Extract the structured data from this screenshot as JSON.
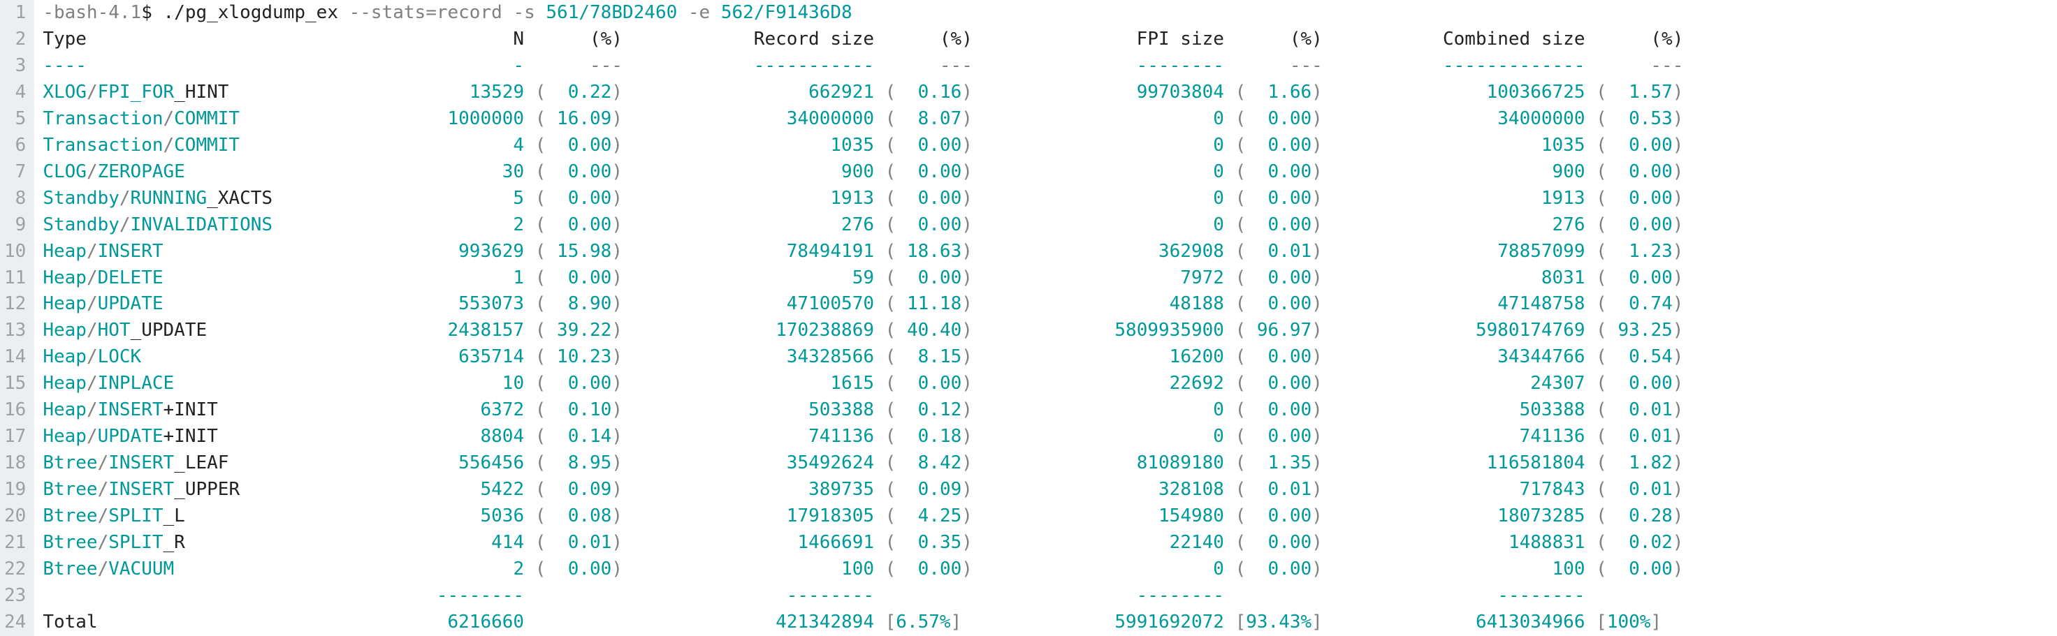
{
  "prompt_prefix": "-bash-4.1",
  "prompt_sigil": "$",
  "cmd": "./pg_xlogdump_ex",
  "flag_stats": "--stats=record",
  "flag_s": "-s",
  "arg_s": "561/78BD2460",
  "flag_e": "-e",
  "arg_e": "562/F91436D8",
  "headers": {
    "type": "Type",
    "n": "N",
    "pct": "(%)",
    "record_size": "Record size",
    "fpi_size": "FPI size",
    "combined_size": "Combined size"
  },
  "dashes": {
    "type": "----",
    "n": "-",
    "pct": "---",
    "record_size": "-----------",
    "fpi_size": "--------",
    "combined_size": "-------------"
  },
  "rows": [
    {
      "name_a": "XLOG",
      "slash": "/",
      "name_b": "FPI_FOR",
      "name_c": "_HINT",
      "n": "13529",
      "npct": "0.22",
      "rs": "662921",
      "rspct": "0.16",
      "fpi": "99703804",
      "fpipct": "1.66",
      "cs": "100366725",
      "cspct": "1.57"
    },
    {
      "name_a": "Transaction",
      "slash": "/",
      "name_b": "COMMIT",
      "name_c": "",
      "n": "1000000",
      "npct": "16.09",
      "rs": "34000000",
      "rspct": "8.07",
      "fpi": "0",
      "fpipct": "0.00",
      "cs": "34000000",
      "cspct": "0.53"
    },
    {
      "name_a": "Transaction",
      "slash": "/",
      "name_b": "COMMIT",
      "name_c": "",
      "n": "4",
      "npct": "0.00",
      "rs": "1035",
      "rspct": "0.00",
      "fpi": "0",
      "fpipct": "0.00",
      "cs": "1035",
      "cspct": "0.00"
    },
    {
      "name_a": "CLOG",
      "slash": "/",
      "name_b": "ZEROPAGE",
      "name_c": "",
      "n": "30",
      "npct": "0.00",
      "rs": "900",
      "rspct": "0.00",
      "fpi": "0",
      "fpipct": "0.00",
      "cs": "900",
      "cspct": "0.00"
    },
    {
      "name_a": "Standby",
      "slash": "/",
      "name_b": "RUNNING",
      "name_c": "_XACTS",
      "n": "5",
      "npct": "0.00",
      "rs": "1913",
      "rspct": "0.00",
      "fpi": "0",
      "fpipct": "0.00",
      "cs": "1913",
      "cspct": "0.00"
    },
    {
      "name_a": "Standby",
      "slash": "/",
      "name_b": "INVALIDATIONS",
      "name_c": "",
      "n": "2",
      "npct": "0.00",
      "rs": "276",
      "rspct": "0.00",
      "fpi": "0",
      "fpipct": "0.00",
      "cs": "276",
      "cspct": "0.00"
    },
    {
      "name_a": "Heap",
      "slash": "/",
      "name_b": "INSERT",
      "name_c": "",
      "n": "993629",
      "npct": "15.98",
      "rs": "78494191",
      "rspct": "18.63",
      "fpi": "362908",
      "fpipct": "0.01",
      "cs": "78857099",
      "cspct": "1.23"
    },
    {
      "name_a": "Heap",
      "slash": "/",
      "name_b": "DELETE",
      "name_c": "",
      "n": "1",
      "npct": "0.00",
      "rs": "59",
      "rspct": "0.00",
      "fpi": "7972",
      "fpipct": "0.00",
      "cs": "8031",
      "cspct": "0.00"
    },
    {
      "name_a": "Heap",
      "slash": "/",
      "name_b": "UPDATE",
      "name_c": "",
      "n": "553073",
      "npct": "8.90",
      "rs": "47100570",
      "rspct": "11.18",
      "fpi": "48188",
      "fpipct": "0.00",
      "cs": "47148758",
      "cspct": "0.74"
    },
    {
      "name_a": "Heap",
      "slash": "/",
      "name_b": "HOT",
      "name_c": "_UPDATE",
      "n": "2438157",
      "npct": "39.22",
      "rs": "170238869",
      "rspct": "40.40",
      "fpi": "5809935900",
      "fpipct": "96.97",
      "cs": "5980174769",
      "cspct": "93.25"
    },
    {
      "name_a": "Heap",
      "slash": "/",
      "name_b": "LOCK",
      "name_c": "",
      "n": "635714",
      "npct": "10.23",
      "rs": "34328566",
      "rspct": "8.15",
      "fpi": "16200",
      "fpipct": "0.00",
      "cs": "34344766",
      "cspct": "0.54"
    },
    {
      "name_a": "Heap",
      "slash": "/",
      "name_b": "INPLACE",
      "name_c": "",
      "n": "10",
      "npct": "0.00",
      "rs": "1615",
      "rspct": "0.00",
      "fpi": "22692",
      "fpipct": "0.00",
      "cs": "24307",
      "cspct": "0.00"
    },
    {
      "name_a": "Heap",
      "slash": "/",
      "name_b": "INSERT",
      "name_c": "+INIT",
      "n": "6372",
      "npct": "0.10",
      "rs": "503388",
      "rspct": "0.12",
      "fpi": "0",
      "fpipct": "0.00",
      "cs": "503388",
      "cspct": "0.01"
    },
    {
      "name_a": "Heap",
      "slash": "/",
      "name_b": "UPDATE",
      "name_c": "+INIT",
      "n": "8804",
      "npct": "0.14",
      "rs": "741136",
      "rspct": "0.18",
      "fpi": "0",
      "fpipct": "0.00",
      "cs": "741136",
      "cspct": "0.01"
    },
    {
      "name_a": "Btree",
      "slash": "/",
      "name_b": "INSERT",
      "name_c": "_LEAF",
      "n": "556456",
      "npct": "8.95",
      "rs": "35492624",
      "rspct": "8.42",
      "fpi": "81089180",
      "fpipct": "1.35",
      "cs": "116581804",
      "cspct": "1.82"
    },
    {
      "name_a": "Btree",
      "slash": "/",
      "name_b": "INSERT",
      "name_c": "_UPPER",
      "n": "5422",
      "npct": "0.09",
      "rs": "389735",
      "rspct": "0.09",
      "fpi": "328108",
      "fpipct": "0.01",
      "cs": "717843",
      "cspct": "0.01"
    },
    {
      "name_a": "Btree",
      "slash": "/",
      "name_b": "SPLIT",
      "name_c": "_L",
      "n": "5036",
      "npct": "0.08",
      "rs": "17918305",
      "rspct": "4.25",
      "fpi": "154980",
      "fpipct": "0.00",
      "cs": "18073285",
      "cspct": "0.28"
    },
    {
      "name_a": "Btree",
      "slash": "/",
      "name_b": "SPLIT",
      "name_c": "_R",
      "n": "414",
      "npct": "0.01",
      "rs": "1466691",
      "rspct": "0.35",
      "fpi": "22140",
      "fpipct": "0.00",
      "cs": "1488831",
      "cspct": "0.02"
    },
    {
      "name_a": "Btree",
      "slash": "/",
      "name_b": "VACUUM",
      "name_c": "",
      "n": "2",
      "npct": "0.00",
      "rs": "100",
      "rspct": "0.00",
      "fpi": "0",
      "fpipct": "0.00",
      "cs": "100",
      "cspct": "0.00"
    }
  ],
  "dashes2": {
    "n": "--------",
    "rs": "--------",
    "fpi": "--------",
    "cs": "--------"
  },
  "total": {
    "label": "Total",
    "n": "6216660",
    "rs": "421342894",
    "rspct": "6.57%",
    "fpi": "5991692072",
    "fpipct": "93.43%",
    "cs": "6413034966",
    "cspct": "100%"
  },
  "chart_data": {
    "type": "table",
    "title": "pg_xlogdump_ex --stats=record",
    "columns": [
      "Type",
      "N",
      "N %",
      "Record size",
      "Record size %",
      "FPI size",
      "FPI size %",
      "Combined size",
      "Combined size %"
    ],
    "rows": [
      [
        "XLOG/FPI_FOR_HINT",
        13529,
        0.22,
        662921,
        0.16,
        99703804,
        1.66,
        100366725,
        1.57
      ],
      [
        "Transaction/COMMIT",
        1000000,
        16.09,
        34000000,
        8.07,
        0,
        0.0,
        34000000,
        0.53
      ],
      [
        "Transaction/COMMIT",
        4,
        0.0,
        1035,
        0.0,
        0,
        0.0,
        1035,
        0.0
      ],
      [
        "CLOG/ZEROPAGE",
        30,
        0.0,
        900,
        0.0,
        0,
        0.0,
        900,
        0.0
      ],
      [
        "Standby/RUNNING_XACTS",
        5,
        0.0,
        1913,
        0.0,
        0,
        0.0,
        1913,
        0.0
      ],
      [
        "Standby/INVALIDATIONS",
        2,
        0.0,
        276,
        0.0,
        0,
        0.0,
        276,
        0.0
      ],
      [
        "Heap/INSERT",
        993629,
        15.98,
        78494191,
        18.63,
        362908,
        0.01,
        78857099,
        1.23
      ],
      [
        "Heap/DELETE",
        1,
        0.0,
        59,
        0.0,
        7972,
        0.0,
        8031,
        0.0
      ],
      [
        "Heap/UPDATE",
        553073,
        8.9,
        47100570,
        11.18,
        48188,
        0.0,
        47148758,
        0.74
      ],
      [
        "Heap/HOT_UPDATE",
        2438157,
        39.22,
        170238869,
        40.4,
        5809935900,
        96.97,
        5980174769,
        93.25
      ],
      [
        "Heap/LOCK",
        635714,
        10.23,
        34328566,
        8.15,
        16200,
        0.0,
        34344766,
        0.54
      ],
      [
        "Heap/INPLACE",
        10,
        0.0,
        1615,
        0.0,
        22692,
        0.0,
        24307,
        0.0
      ],
      [
        "Heap/INSERT+INIT",
        6372,
        0.1,
        503388,
        0.12,
        0,
        0.0,
        503388,
        0.01
      ],
      [
        "Heap/UPDATE+INIT",
        8804,
        0.14,
        741136,
        0.18,
        0,
        0.0,
        741136,
        0.01
      ],
      [
        "Btree/INSERT_LEAF",
        556456,
        8.95,
        35492624,
        8.42,
        81089180,
        1.35,
        116581804,
        1.82
      ],
      [
        "Btree/INSERT_UPPER",
        5422,
        0.09,
        389735,
        0.09,
        328108,
        0.01,
        717843,
        0.01
      ],
      [
        "Btree/SPLIT_L",
        5036,
        0.08,
        17918305,
        4.25,
        154980,
        0.0,
        18073285,
        0.28
      ],
      [
        "Btree/SPLIT_R",
        414,
        0.01,
        1466691,
        0.35,
        22140,
        0.0,
        1488831,
        0.02
      ],
      [
        "Btree/VACUUM",
        2,
        0.0,
        100,
        0.0,
        0,
        0.0,
        100,
        0.0
      ]
    ],
    "total": [
      "Total",
      6216660,
      null,
      421342894,
      6.57,
      5991692072,
      93.43,
      6413034966,
      100
    ]
  }
}
